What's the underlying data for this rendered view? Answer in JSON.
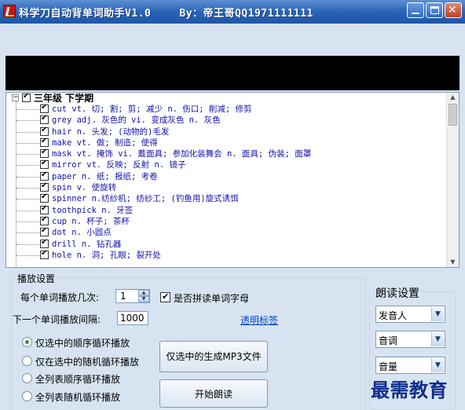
{
  "window": {
    "title": "科学刀自动背单词助手V1.0",
    "author": "By：帝王哥QQ1971111111",
    "buttons": [
      "minimize",
      "maximize",
      "close"
    ]
  },
  "tree": {
    "root_label": "三年级 下学期",
    "expander": "−",
    "items": [
      {
        "text": "cut    vt. 切; 割; 剪; 减少 n. 伤口; 削减; 修剪",
        "checked": true
      },
      {
        "text": "grey    adj. 灰色的 vi. 变成灰色 n. 灰色",
        "checked": true
      },
      {
        "text": "hair    n. 头发; (动物的)毛发",
        "checked": true
      },
      {
        "text": "make    vt. 做; 制造; 使得",
        "checked": true
      },
      {
        "text": "mask    vt. 掩饰 vi. 戴面具; 参加化装舞会 n. 面具; 伪装; 面罩",
        "checked": true
      },
      {
        "text": "mirror    vt. 反映; 反射 n. 镜子",
        "checked": true
      },
      {
        "text": "paper    n. 纸; 报纸; 考卷",
        "checked": true
      },
      {
        "text": "spin    v. 使旋转",
        "checked": true
      },
      {
        "text": "spinner    n.纺纱机;  纺纱工;  (钓鱼用)旋式诱饵",
        "checked": true
      },
      {
        "text": "toothpick    n. 牙签",
        "checked": true
      },
      {
        "text": "cup    n. 杯子; 茶杯",
        "checked": true
      },
      {
        "text": "dot    n. 小圆点",
        "checked": true
      },
      {
        "text": "drill    n. 钻孔器",
        "checked": true
      },
      {
        "text": "hole    n. 洞; 孔眼; 裂开处",
        "checked": true
      }
    ]
  },
  "play_settings": {
    "title": "播放设置",
    "repeat_label": "每个单词播放几次:",
    "repeat_value": "1",
    "spell_check_label": "是否拼读单词字母",
    "spell_checked": true,
    "interval_label": "下一个单词播放间隔:",
    "interval_value": "1000",
    "transparent_link": "透明标签",
    "modes": [
      {
        "label": "仅选中的顺序循环播放",
        "selected": true
      },
      {
        "label": "仅在选中的随机循环播放",
        "selected": false
      },
      {
        "label": "全列表顺序循环播放",
        "selected": false
      },
      {
        "label": "全列表随机循环播放",
        "selected": false
      }
    ],
    "generate_mp3_button": "仅选中的生成MP3文件",
    "start_button": "开始朗读"
  },
  "read_settings": {
    "title": "朗读设置",
    "speaker": "发音人",
    "pitch": "音调",
    "volume": "音量"
  },
  "watermark": "最需教育",
  "colors": {
    "titlebar": "#2a64b8",
    "word_text": "#1111aa",
    "link": "#0044cc"
  }
}
